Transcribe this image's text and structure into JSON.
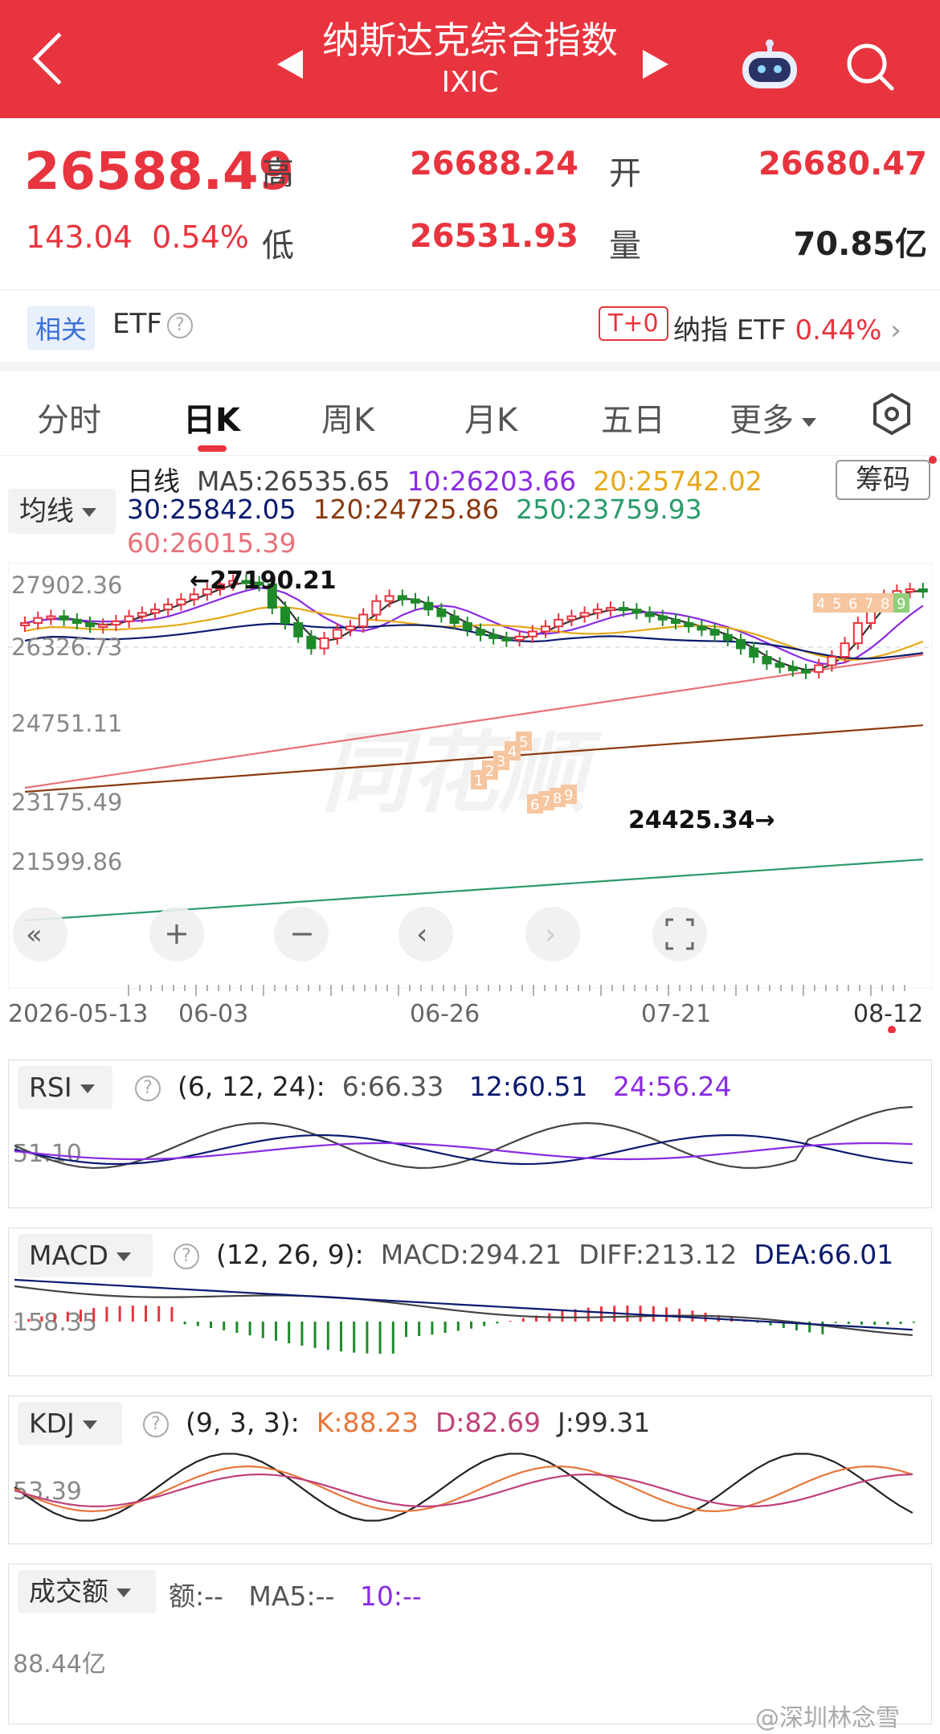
{
  "header": {
    "title": "纳斯达克综合指数",
    "subtitle": "IXIC"
  },
  "quote": {
    "price": "26588.49",
    "change": "143.04",
    "change_pct": "0.54%",
    "high_label": "高",
    "high": "26688.24",
    "low_label": "低",
    "low": "26531.93",
    "open_label": "开",
    "open": "26680.47",
    "volume_label": "量",
    "volume": "70.85亿"
  },
  "etf_bar": {
    "related_tag": "相关",
    "etf_label": "ETF",
    "t0_tag": "T+0",
    "nasdaq_etf_label": "纳指 ETF",
    "nasdaq_etf_pct": "0.44%"
  },
  "tabs": [
    "分时",
    "日K",
    "周K",
    "月K",
    "五日",
    "更多"
  ],
  "active_tab": "日K",
  "ma": {
    "selector": "均线",
    "line_label": "日线",
    "ma5": "MA5:26535.65",
    "ma10": "10:26203.66",
    "ma20": "20:25742.02",
    "ma30": "30:25842.05",
    "ma120": "120:24725.86",
    "ma250": "250:23759.93",
    "ma60": "60:26015.39",
    "chips_label": "筹码"
  },
  "colors": {
    "up": "#e8343e",
    "down": "#1e8a2a",
    "ma5": "#333333",
    "ma10": "#8a2be2",
    "ma20": "#e6a817",
    "ma30": "#0a1a6e",
    "ma60": "#e8727a",
    "ma120": "#8b3a0f",
    "ma250": "#2a9a6a"
  },
  "chart_data": {
    "type": "candlestick",
    "y_ticks": [
      "27902.36",
      "26326.73",
      "24751.11",
      "23175.49",
      "21599.86"
    ],
    "x_ticks": [
      "2026-05-13",
      "06-03",
      "06-26",
      "07-21",
      "08-12"
    ],
    "high_annotation": "←27190.21",
    "low_annotation": "24425.34→",
    "td_sequential_up": [
      "4",
      "5",
      "6",
      "7",
      "8",
      "9"
    ],
    "td_sequential_down": [
      "1",
      "2",
      "3",
      "4",
      "5",
      "6",
      "7",
      "8",
      "9"
    ]
  },
  "rsi": {
    "selector": "RSI",
    "params": "(6, 12, 24):",
    "r6": "6:66.33",
    "r12": "12:60.51",
    "r24": "24:56.24",
    "level": "51.10"
  },
  "macd": {
    "selector": "MACD",
    "params": "(12, 26, 9):",
    "macd": "MACD:294.21",
    "diff": "DIFF:213.12",
    "dea": "DEA:66.01",
    "level": "158.35"
  },
  "kdj": {
    "selector": "KDJ",
    "params": "(9, 3, 3):",
    "k": "K:88.23",
    "d": "D:82.69",
    "j": "J:99.31",
    "level": "53.39"
  },
  "turnover": {
    "selector": "成交额",
    "amount": "额:--",
    "ma5": "MA5:--",
    "ma10": "10:--",
    "level": "88.44亿"
  },
  "watermark": "@深圳林念雪"
}
